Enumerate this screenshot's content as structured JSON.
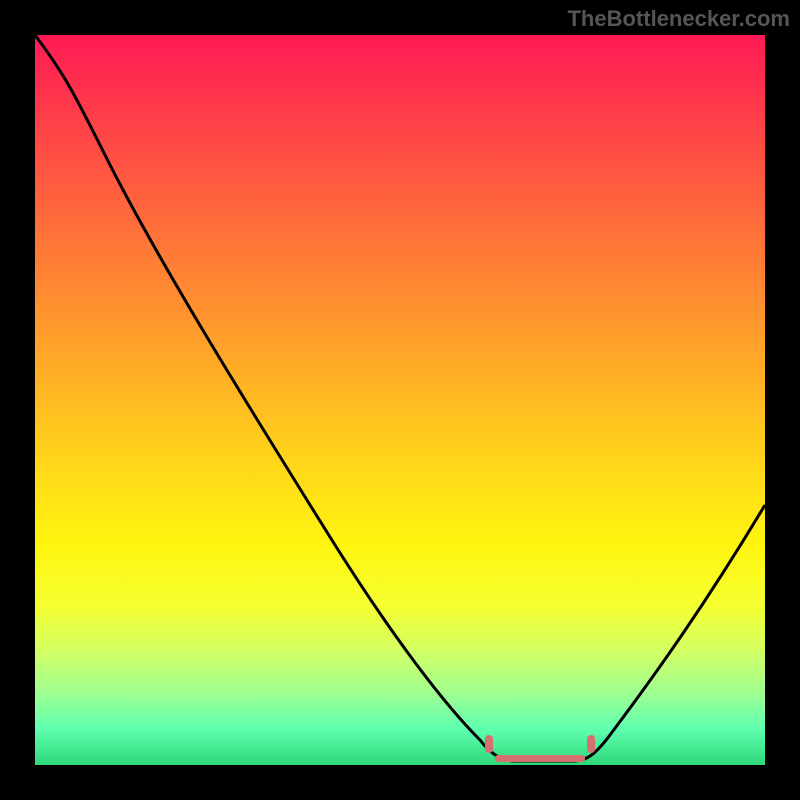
{
  "watermark": "TheBottlenecker.com",
  "chart_data": {
    "type": "line",
    "title": "",
    "xlabel": "",
    "ylabel": "",
    "xlim": [
      0,
      100
    ],
    "ylim": [
      0,
      100
    ],
    "gradient_meaning": "red=high bottleneck, green=low bottleneck",
    "curve_points": [
      {
        "x": 0,
        "y": 100
      },
      {
        "x": 5,
        "y": 96
      },
      {
        "x": 10,
        "y": 89
      },
      {
        "x": 20,
        "y": 73
      },
      {
        "x": 30,
        "y": 57
      },
      {
        "x": 40,
        "y": 41
      },
      {
        "x": 50,
        "y": 25
      },
      {
        "x": 58,
        "y": 11
      },
      {
        "x": 62,
        "y": 3
      },
      {
        "x": 65,
        "y": 0.5
      },
      {
        "x": 72,
        "y": 0.5
      },
      {
        "x": 76,
        "y": 3
      },
      {
        "x": 85,
        "y": 14
      },
      {
        "x": 92,
        "y": 24
      },
      {
        "x": 100,
        "y": 36
      }
    ],
    "optimal_band": {
      "x_start": 62,
      "x_end": 76,
      "y": 2
    },
    "marker_color": "#d67070"
  }
}
